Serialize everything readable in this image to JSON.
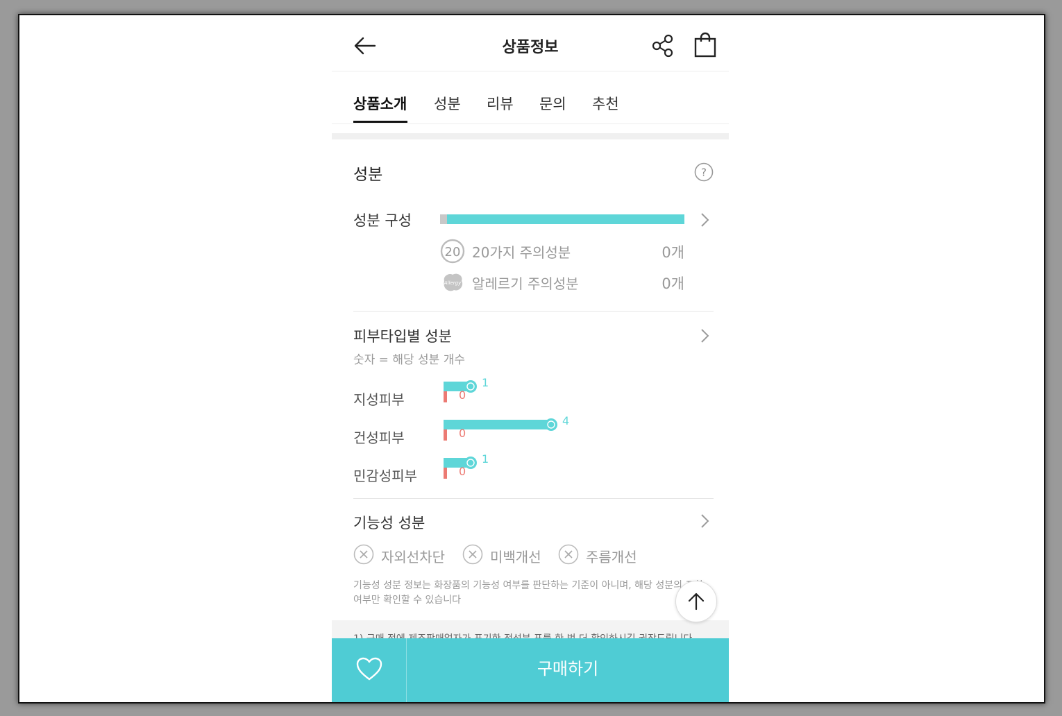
{
  "header": {
    "title": "상품정보",
    "back_icon": "arrow-left-icon",
    "share_icon": "share-icon",
    "cart_icon": "shopping-bag-icon"
  },
  "tabs": [
    {
      "label": "상품소개",
      "active": true
    },
    {
      "label": "성분",
      "active": false
    },
    {
      "label": "리뷰",
      "active": false
    },
    {
      "label": "문의",
      "active": false
    },
    {
      "label": "추천",
      "active": false
    }
  ],
  "ingredients": {
    "title": "성분",
    "help_icon": "question-circle-icon",
    "composition_label": "성분 구성",
    "warn20": {
      "badge": "20",
      "label": "20가지 주의성분",
      "count": "0개"
    },
    "allergy": {
      "badge": "Allergy",
      "label": "알레르기 주의성분",
      "count": "0개"
    }
  },
  "skin_type": {
    "title": "피부타입별 성분",
    "subtitle": "숫자 = 해당 성분 개수",
    "rows": [
      {
        "label": "지성피부",
        "good": 1,
        "bad": 0,
        "good_text": "1",
        "bad_text": "0"
      },
      {
        "label": "건성피부",
        "good": 4,
        "bad": 0,
        "good_text": "4",
        "bad_text": "0"
      },
      {
        "label": "민감성피부",
        "good": 1,
        "bad": 0,
        "good_text": "1",
        "bad_text": "0"
      }
    ]
  },
  "functional": {
    "title": "기능성 성분",
    "items": [
      "자외선차단",
      "미백개선",
      "주름개선"
    ],
    "note": "기능성 성분 정보는 화장품의 기능성 여부를 판단하는 기준이 아니며, 해당 성분의 포함 여부만 확인할 수 있습니다"
  },
  "footer_note": "1) 구매 전에 제조판매업자가 표기한 전성분 표를 한 번 더 확인하시길 권장드립니다.",
  "bottom": {
    "heart_icon": "heart-outline-icon",
    "buy_label": "구매하기"
  },
  "colors": {
    "accent": "#4fccd4",
    "good_bar": "#5ed6d8",
    "bad_bar": "#ec7a73"
  }
}
